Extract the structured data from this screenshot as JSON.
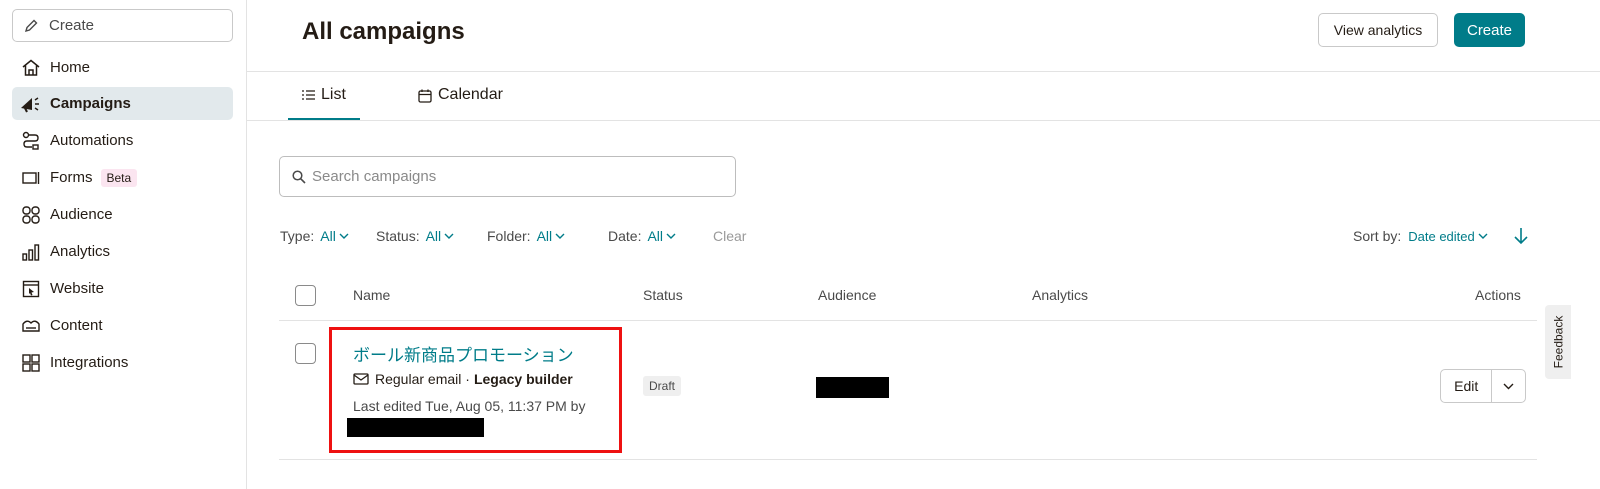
{
  "sidebar": {
    "create_label": "Create",
    "items": [
      {
        "label": "Home",
        "icon": "home-icon"
      },
      {
        "label": "Campaigns",
        "icon": "megaphone-icon",
        "active": true
      },
      {
        "label": "Automations",
        "icon": "automations-icon"
      },
      {
        "label": "Forms",
        "icon": "forms-icon",
        "badge": "Beta"
      },
      {
        "label": "Audience",
        "icon": "audience-icon"
      },
      {
        "label": "Analytics",
        "icon": "analytics-icon"
      },
      {
        "label": "Website",
        "icon": "website-icon"
      },
      {
        "label": "Content",
        "icon": "content-icon"
      },
      {
        "label": "Integrations",
        "icon": "integrations-icon"
      }
    ]
  },
  "header": {
    "title": "All campaigns",
    "view_analytics_label": "View analytics",
    "create_label": "Create"
  },
  "tabs": [
    {
      "label": "List",
      "active": true
    },
    {
      "label": "Calendar"
    }
  ],
  "search": {
    "placeholder": "Search campaigns"
  },
  "filters": {
    "type_label": "Type:",
    "type_value": "All",
    "status_label": "Status:",
    "status_value": "All",
    "folder_label": "Folder:",
    "folder_value": "All",
    "date_label": "Date:",
    "date_value": "All",
    "clear_label": "Clear",
    "sort_label": "Sort by:",
    "sort_value": "Date edited"
  },
  "table": {
    "headers": {
      "name": "Name",
      "status": "Status",
      "audience": "Audience",
      "analytics": "Analytics",
      "actions": "Actions"
    },
    "rows": [
      {
        "name": "ボール新商品プロモーション",
        "type": "Regular email ·",
        "builder": "Legacy builder",
        "edited": "Last edited Tue, Aug 05, 11:37 PM by",
        "status": "Draft",
        "edit_label": "Edit"
      }
    ]
  },
  "feedback_label": "Feedback",
  "colors": {
    "accent": "#007c89",
    "active_nav": "#e2e9ec",
    "highlight": "#ee1111"
  }
}
